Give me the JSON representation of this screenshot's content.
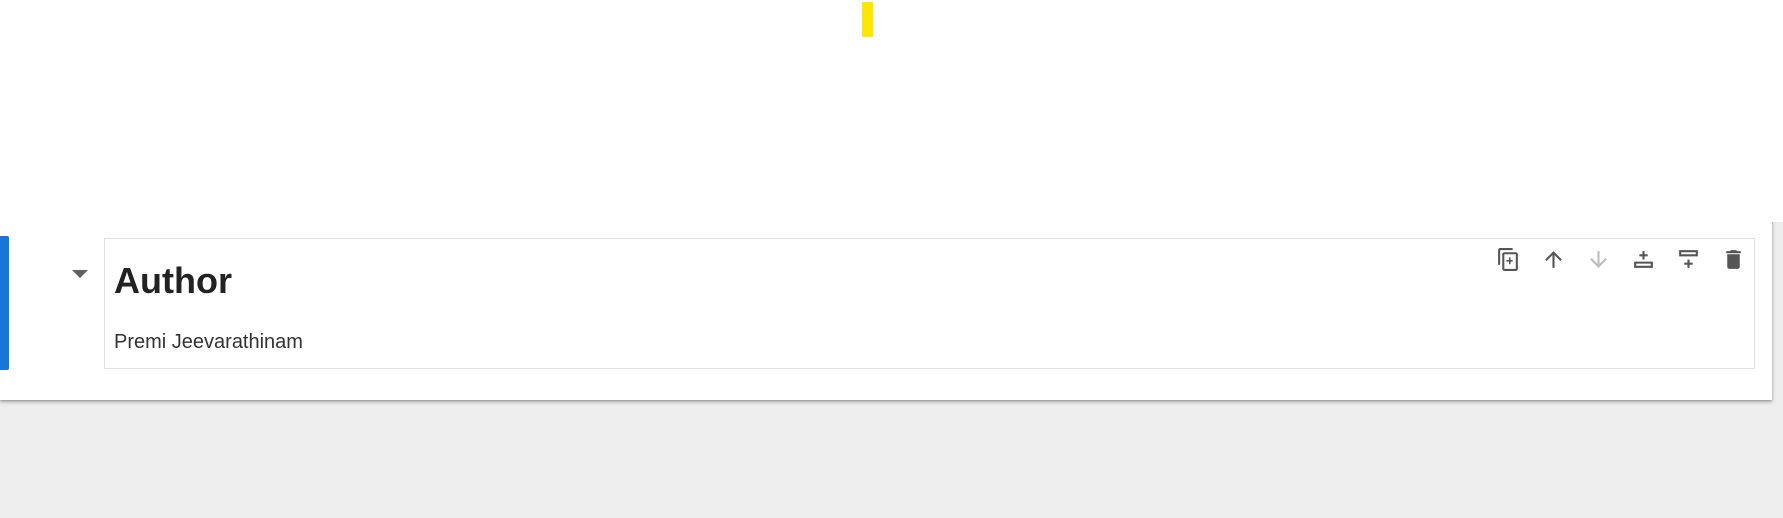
{
  "cell": {
    "heading": "Author",
    "text": "Premi Jeevarathinam"
  },
  "toolbar": {
    "buttons": [
      {
        "icon": "duplicate-icon",
        "enabled": true
      },
      {
        "icon": "arrow-up-icon",
        "enabled": true
      },
      {
        "icon": "arrow-down-icon",
        "enabled": false
      },
      {
        "icon": "insert-above-icon",
        "enabled": true
      },
      {
        "icon": "insert-below-icon",
        "enabled": true
      },
      {
        "icon": "trash-icon",
        "enabled": true
      }
    ]
  },
  "colors": {
    "active_bar": "#1976d2",
    "cursor_mark": "#ffe600",
    "background": "#eeeeee"
  }
}
